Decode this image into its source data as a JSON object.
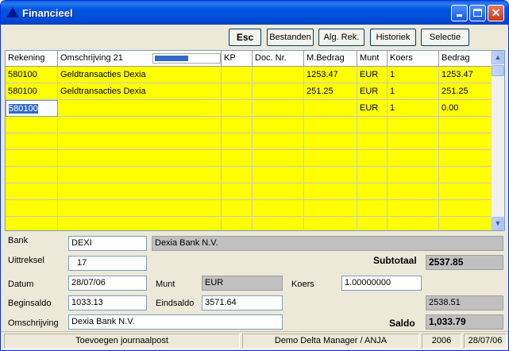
{
  "window": {
    "title": "Financieel"
  },
  "toolbar": {
    "esc": "Esc",
    "bestanden": "Bestanden",
    "alg_rek": "Alg. Rek.",
    "historiek": "Historiek",
    "selectie": "Selectie"
  },
  "grid": {
    "headers": {
      "rekening": "Rekening",
      "omschrijving": "Omschrijving 21",
      "kp": "KP",
      "doc_nr": "Doc. Nr.",
      "m_bedrag": "M.Bedrag",
      "munt": "Munt",
      "koers": "Koers",
      "bedrag": "Bedrag"
    },
    "progress_fraction": 0.52,
    "rows": [
      {
        "rekening": "580100",
        "omschrijving": "Geldtransacties Dexia",
        "kp": "",
        "doc_nr": "",
        "m_bedrag": "1253.47",
        "munt": "EUR",
        "koers": "1",
        "bedrag": "1253.47"
      },
      {
        "rekening": "580100",
        "omschrijving": "Geldtransacties Dexia",
        "kp": "",
        "doc_nr": "",
        "m_bedrag": "251.25",
        "munt": "EUR",
        "koers": "1",
        "bedrag": "251.25"
      },
      {
        "rekening": "580100",
        "omschrijving": "",
        "kp": "",
        "doc_nr": "",
        "m_bedrag": "",
        "munt": "EUR",
        "koers": "1",
        "bedrag": "0.00"
      }
    ],
    "empty_rows": 7
  },
  "form": {
    "bank_label": "Bank",
    "bank_code": "DEXI",
    "bank_name": "Dexia Bank N.V.",
    "uittreksel_label": "Uittreksel",
    "uittreksel": "17",
    "subtotaal_label": "Subtotaal",
    "subtotaal": "2537.85",
    "datum_label": "Datum",
    "datum": "28/07/06",
    "munt_label": "Munt",
    "munt": "EUR",
    "koers_label": "Koers",
    "koers": "1.00000000",
    "beginsaldo_label": "Beginsaldo",
    "beginsaldo": "1033.13",
    "eindsaldo_label": "Eindsaldo",
    "eindsaldo": "3571.64",
    "right_value": "2538.51",
    "omschrijving_label": "Omschrijving",
    "omschrijving": "Dexia Bank N.V.",
    "saldo_label": "Saldo",
    "saldo": "1,033.79"
  },
  "status": {
    "action": "Toevoegen journaalpost",
    "app": "Demo Delta Manager / ANJA",
    "year": "2006",
    "date": "28/07/06"
  }
}
